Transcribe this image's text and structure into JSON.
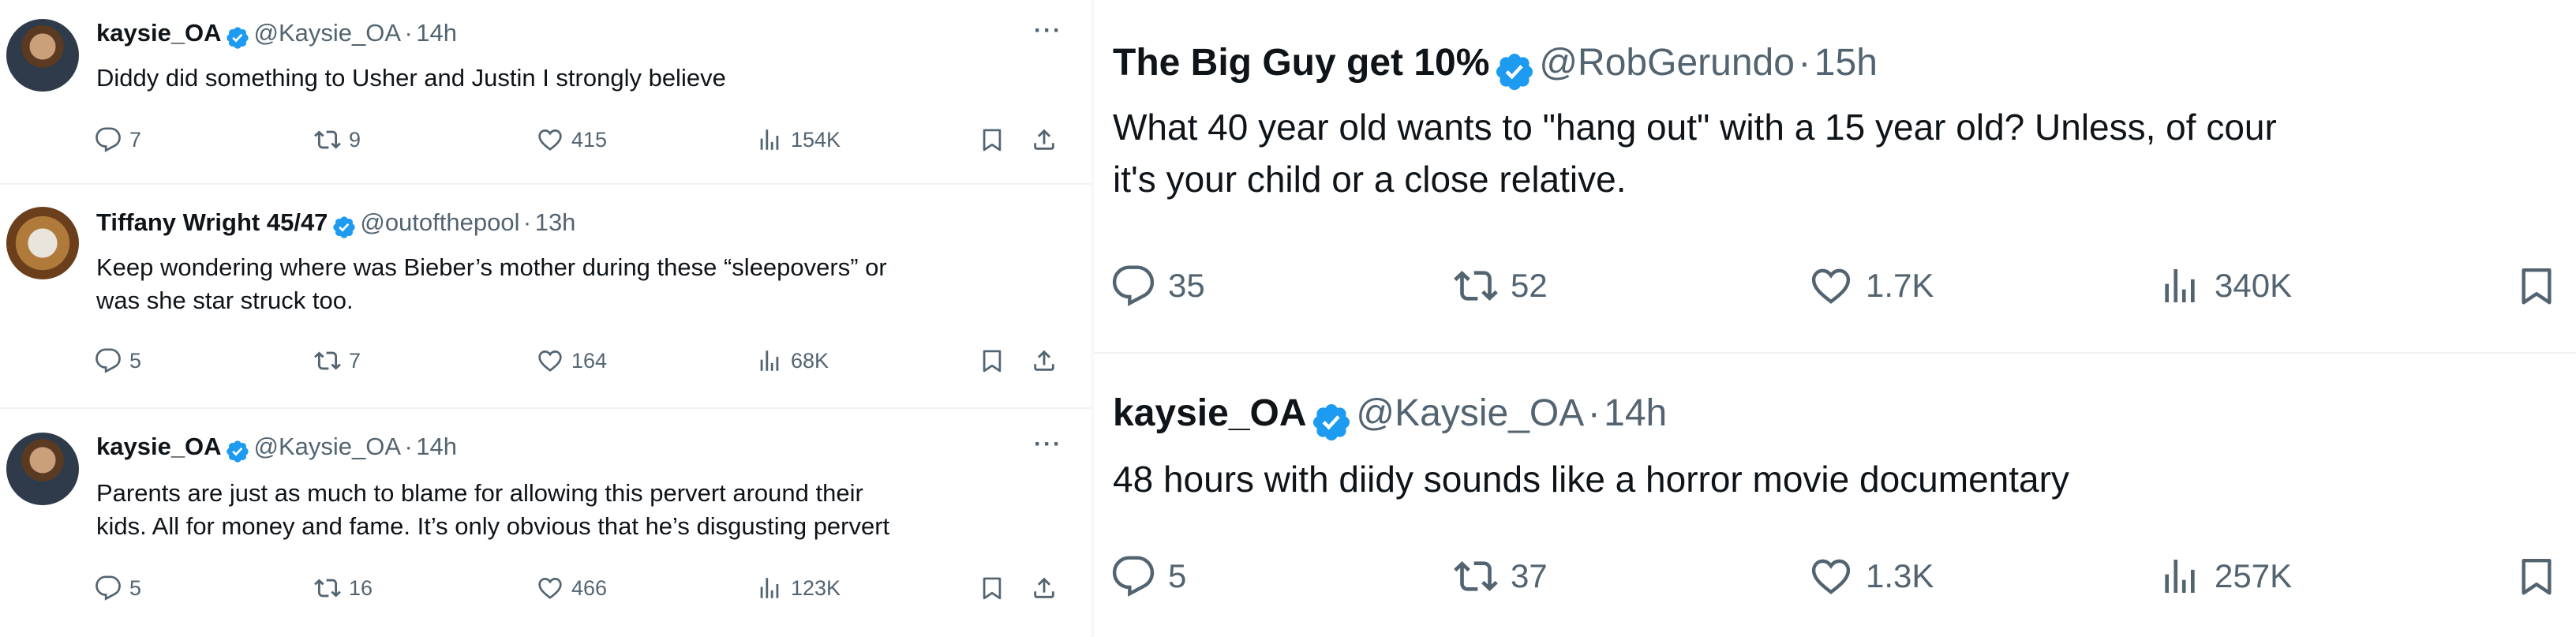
{
  "left": {
    "tweets": [
      {
        "name": "kaysie_OA",
        "handle": "@Kaysie_OA",
        "dot": "·",
        "time": "14h",
        "text": "Diddy did something to Usher and Justin I strongly believe",
        "replies": "7",
        "reposts": "9",
        "likes": "415",
        "views": "154K"
      },
      {
        "name": "Tiffany Wright 45/47",
        "handle": "@outofthepool",
        "dot": "·",
        "time": "13h",
        "text_line1": "Keep wondering where was Bieber’s mother during these “sleepovers” or",
        "text_line2": "was she star struck too.",
        "replies": "5",
        "reposts": "7",
        "likes": "164",
        "views": "68K"
      },
      {
        "name": "kaysie_OA",
        "handle": "@Kaysie_OA",
        "dot": "·",
        "time": "14h",
        "text_line1": "Parents are just as much to blame for allowing this pervert around their",
        "text_line2": "kids. All for money and fame. It’s only obvious that he’s disgusting pervert",
        "replies": "5",
        "reposts": "16",
        "likes": "466",
        "views": "123K"
      }
    ],
    "more_label": "···"
  },
  "right": {
    "tweets": [
      {
        "name": "The Big Guy get 10%",
        "handle": "@RobGerundo",
        "dot": "·",
        "time": "15h",
        "text_line1": "What 40 year old wants to \"hang out\" with a 15 year old?  Unless, of cour",
        "text_line2": "it's your child or a close relative.",
        "replies": "35",
        "reposts": "52",
        "likes": "1.7K",
        "views": "340K"
      },
      {
        "name": "kaysie_OA",
        "handle": "@Kaysie_OA",
        "dot": "·",
        "time": "14h",
        "text": "48 hours with diidy sounds like a horror movie documentary",
        "replies": "5",
        "reposts": "37",
        "likes": "1.3K",
        "views": "257K"
      }
    ]
  },
  "icons": {
    "reply": "reply-icon",
    "repost": "repost-icon",
    "like": "like-icon",
    "views": "views-icon",
    "bookmark": "bookmark-icon",
    "share": "share-icon",
    "verified": "verified-badge-icon"
  },
  "colors": {
    "text": "#0f1419",
    "secondary": "#536471",
    "verified": "#1d9bf0",
    "separator": "#eff3f4"
  }
}
